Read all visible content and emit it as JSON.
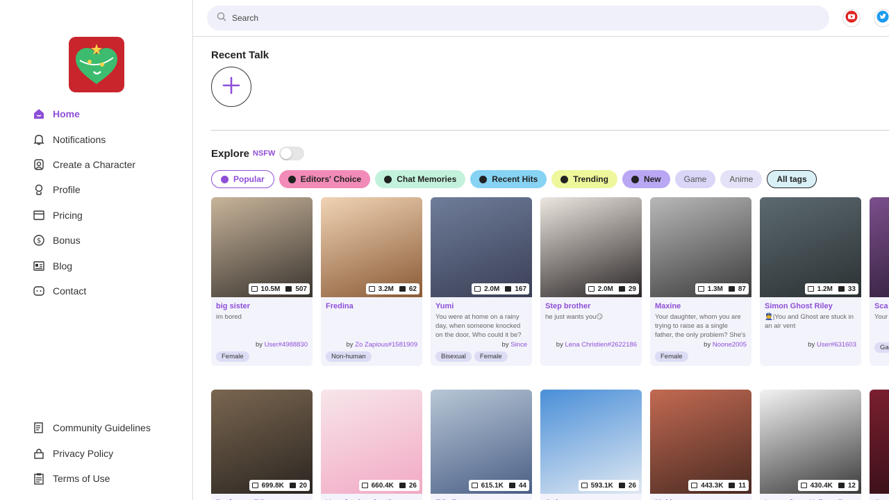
{
  "sidebar": {
    "nav": [
      {
        "label": "Home",
        "icon": "home-icon",
        "active": true
      },
      {
        "label": "Notifications",
        "icon": "bell-icon"
      },
      {
        "label": "Create a Character",
        "icon": "create-character-icon"
      },
      {
        "label": "Profile",
        "icon": "profile-icon"
      },
      {
        "label": "Pricing",
        "icon": "pricing-icon"
      },
      {
        "label": "Bonus",
        "icon": "dollar-icon"
      },
      {
        "label": "Blog",
        "icon": "blog-icon"
      },
      {
        "label": "Contact",
        "icon": "chat-icon"
      }
    ],
    "bottom": [
      {
        "label": "Community Guidelines",
        "icon": "guidelines-icon"
      },
      {
        "label": "Privacy Policy",
        "icon": "lock-icon"
      },
      {
        "label": "Terms of Use",
        "icon": "clipboard-icon"
      }
    ]
  },
  "search": {
    "placeholder": "Search"
  },
  "recent_talk": {
    "title": "Recent Talk"
  },
  "explore": {
    "title": "Explore",
    "nsfw_label": "NSFW"
  },
  "tags": [
    {
      "label": "Popular",
      "bg": "#ffffff",
      "border": "#8e4fd8",
      "color": "#8e4fd8",
      "dot": "#8e4fd8"
    },
    {
      "label": "Editors' Choice",
      "bg": "#f28bb8",
      "color": "#222"
    },
    {
      "label": "Chat Memories",
      "bg": "#c3f2dc",
      "color": "#222"
    },
    {
      "label": "Recent Hits",
      "bg": "#86d3f3",
      "color": "#222"
    },
    {
      "label": "Trending",
      "bg": "#eef79b",
      "color": "#222"
    },
    {
      "label": "New",
      "bg": "#b9a7f3",
      "color": "#222"
    },
    {
      "label": "Game",
      "bg": "#d9d6f7",
      "color": "#555",
      "plain": true
    },
    {
      "label": "Anime",
      "bg": "#e4e2f7",
      "color": "#555",
      "plain": true
    },
    {
      "label": "All tags",
      "bg": "#d9f0f7",
      "border": "#222",
      "color": "#222"
    }
  ],
  "cards_row1": [
    {
      "name": "big sister",
      "desc": "im bored",
      "author": "User#4988830",
      "chats": "10.5M",
      "saves": "507",
      "tags": [
        "Female"
      ],
      "colors": [
        "#c8b49a",
        "#3a3530"
      ]
    },
    {
      "name": "Fredina",
      "desc": "",
      "author": "Zo Zapious#1581909",
      "chats": "3.2M",
      "saves": "62",
      "tags": [
        "Non-human"
      ],
      "colors": [
        "#f0d4b5",
        "#8a5a36"
      ]
    },
    {
      "name": "Yumi",
      "desc": "You were at home on a rainy day, when someone knocked on the door, Who could it be?",
      "author": "Since",
      "chats": "2.0M",
      "saves": "167",
      "tags": [
        "Bisexual",
        "Female"
      ],
      "colors": [
        "#6f7d9a",
        "#3a3f55"
      ]
    },
    {
      "name": "Step brother",
      "desc": "he just wants you😏",
      "author": "Lena Christien#2622186",
      "chats": "2.0M",
      "saves": "29",
      "tags": [],
      "colors": [
        "#ede6e0",
        "#2a2626"
      ]
    },
    {
      "name": "Maxine",
      "desc": "Your daughter, whom you are trying to raise as a single father, the only problem? She's",
      "author": "Noone2005",
      "chats": "1.3M",
      "saves": "87",
      "tags": [
        "Female"
      ],
      "colors": [
        "#b8b8b8",
        "#3c3c3c"
      ]
    },
    {
      "name": "Simon Ghost Riley",
      "desc": "👮|You and Ghost are stuck in an air vent",
      "author": "User#631603",
      "chats": "1.2M",
      "saves": "33",
      "tags": [],
      "colors": [
        "#5c6a70",
        "#2b3133"
      ]
    },
    {
      "name": "Sca",
      "desc": "Your",
      "author": "",
      "chats": "",
      "saves": "",
      "tags": [
        "Ga"
      ],
      "colors": [
        "#7b4f8c",
        "#2b1a33"
      ]
    }
  ],
  "cards_row2": [
    {
      "name": "Professor Ethan",
      "chats": "699.8K",
      "saves": "20",
      "colors": [
        "#7a6650",
        "#2b2621"
      ]
    },
    {
      "name": "Your femboy brother",
      "chats": "660.4K",
      "saves": "26",
      "colors": [
        "#f7e6ea",
        "#f2a9c4"
      ]
    },
    {
      "name": "Ethelle",
      "chats": "615.1K",
      "saves": "44",
      "colors": [
        "#b7c7d6",
        "#4b5f86"
      ]
    },
    {
      "name": "Gojo",
      "chats": "593.1K",
      "saves": "26",
      "colors": [
        "#4a8fd8",
        "#dfe8f2"
      ]
    },
    {
      "name": "Makima",
      "chats": "443.3K",
      "saves": "11",
      "colors": [
        "#c26a52",
        "#4a2a22"
      ]
    },
    {
      "name": "Loona from Helluva Boss",
      "chats": "430.4K",
      "saves": "12",
      "colors": [
        "#f3f3f3",
        "#3a3a3a"
      ]
    },
    {
      "name": "Cu",
      "chats": "",
      "saves": "",
      "colors": [
        "#7b1f2f",
        "#2a0d14"
      ]
    }
  ],
  "brand": {
    "accent": "#8e4fd8",
    "logo_bg": "#c9252c",
    "logo_heart": "#3dbb6e"
  }
}
